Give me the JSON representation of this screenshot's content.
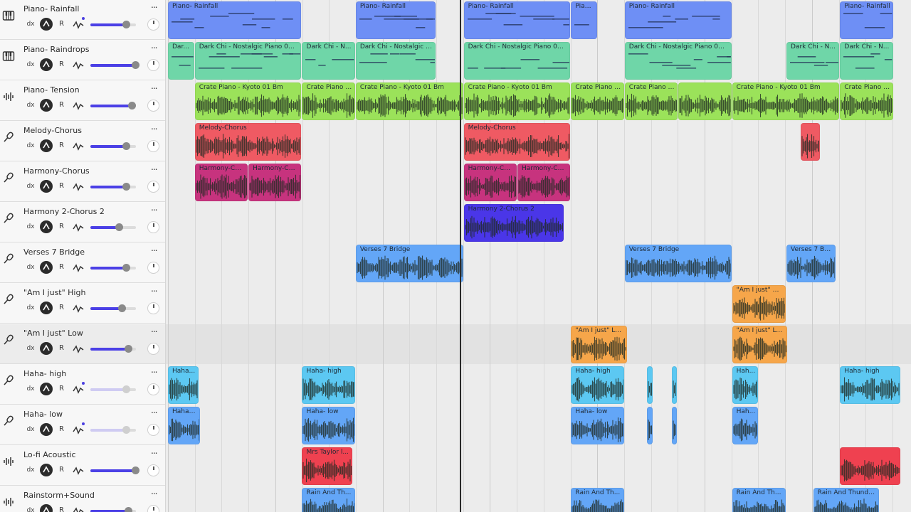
{
  "colors": {
    "accent": "#4b40e6",
    "blue": "#6e8ff5",
    "teal": "#6fd6a8",
    "green": "#9be25a",
    "red": "#ef5a63",
    "magenta": "#c7337e",
    "indigo": "#4a36e8",
    "skyblue": "#63a6f7",
    "orange": "#f6a64a",
    "cyan": "#5cc8f2",
    "rose": "#ef4150"
  },
  "icons": {
    "midi": "piano-keys-icon",
    "audio": "waveform-icon",
    "mic": "microphone-icon",
    "more": "ellipsis-icon",
    "mute": "mute-icon",
    "automation": "automation-icon",
    "pan": "pan-knob-icon"
  },
  "controls": {
    "fx": "dx",
    "record": "R",
    "more": "..."
  },
  "tracks": [
    {
      "name": "Piano- Rainfall",
      "kind": "midi",
      "volume": 0.78,
      "dim": false,
      "automation_dot": true
    },
    {
      "name": "Piano- Raindrops",
      "kind": "midi",
      "volume": 0.98,
      "dim": false,
      "automation_dot": false
    },
    {
      "name": "Piano- Tension",
      "kind": "audio",
      "volume": 0.9,
      "dim": false,
      "automation_dot": false
    },
    {
      "name": "Melody-Chorus",
      "kind": "mic",
      "volume": 0.78,
      "dim": false,
      "automation_dot": false
    },
    {
      "name": "Harmony-Chorus",
      "kind": "mic",
      "volume": 0.78,
      "dim": false,
      "automation_dot": false
    },
    {
      "name": "Harmony 2-Chorus 2",
      "kind": "mic",
      "volume": 0.63,
      "dim": false,
      "automation_dot": false
    },
    {
      "name": "Verses 7 Bridge",
      "kind": "mic",
      "volume": 0.78,
      "dim": false,
      "automation_dot": false
    },
    {
      "name": "\"Am I just\" High",
      "kind": "mic",
      "volume": 0.68,
      "dim": false,
      "automation_dot": false
    },
    {
      "name": "\"Am I just\" Low",
      "kind": "mic",
      "volume": 0.83,
      "dim": false,
      "automation_dot": false,
      "selected": true
    },
    {
      "name": "Haha- high",
      "kind": "mic",
      "volume": 0.78,
      "dim": true,
      "automation_dot": true
    },
    {
      "name": "Haha- low",
      "kind": "mic",
      "volume": 0.78,
      "dim": true,
      "automation_dot": true
    },
    {
      "name": "Lo-fi Acoustic",
      "kind": "audio",
      "volume": 0.98,
      "dim": false,
      "automation_dot": false
    },
    {
      "name": "Rainstorm+Sound",
      "kind": "audio",
      "volume": 0.83,
      "dim": false,
      "automation_dot": false
    }
  ],
  "regions": [
    {
      "track": 0,
      "name": "Piano- Rainfall",
      "start": 0.0,
      "end": 0.18,
      "color": "blue",
      "style": "midi"
    },
    {
      "track": 0,
      "name": "Piano- Rainfall",
      "start": 0.252,
      "end": 0.36,
      "color": "blue",
      "style": "midi"
    },
    {
      "track": 0,
      "name": "Piano- Rainfall",
      "start": 0.397,
      "end": 0.541,
      "color": "blue",
      "style": "midi"
    },
    {
      "track": 0,
      "name": "Pian...",
      "start": 0.541,
      "end": 0.577,
      "color": "blue",
      "style": "midi"
    },
    {
      "track": 0,
      "name": "Piano- Rainfall",
      "start": 0.613,
      "end": 0.757,
      "color": "blue",
      "style": "midi"
    },
    {
      "track": 0,
      "name": "Piano- Rainfall",
      "start": 0.902,
      "end": 0.974,
      "color": "blue",
      "style": "midi"
    },
    {
      "track": 1,
      "name": "Dar...",
      "start": 0.0,
      "end": 0.036,
      "color": "teal",
      "style": "midi"
    },
    {
      "track": 1,
      "name": "Dark Chi - Nostalgic Piano 07 D",
      "start": 0.036,
      "end": 0.18,
      "color": "teal",
      "style": "midi"
    },
    {
      "track": 1,
      "name": "Dark Chi - N...",
      "start": 0.18,
      "end": 0.252,
      "color": "teal",
      "style": "midi"
    },
    {
      "track": 1,
      "name": "Dark Chi - Nostalgic P...",
      "start": 0.252,
      "end": 0.36,
      "color": "teal",
      "style": "midi"
    },
    {
      "track": 1,
      "name": "Dark Chi - Nostalgic Piano 07 D",
      "start": 0.397,
      "end": 0.541,
      "color": "teal",
      "style": "midi"
    },
    {
      "track": 1,
      "name": "Dark Chi - Nostalgic Piano 07 D",
      "start": 0.613,
      "end": 0.757,
      "color": "teal",
      "style": "midi"
    },
    {
      "track": 1,
      "name": "Dark Chi - N...",
      "start": 0.83,
      "end": 0.902,
      "color": "teal",
      "style": "midi"
    },
    {
      "track": 1,
      "name": "Dark Chi - N...",
      "start": 0.902,
      "end": 0.974,
      "color": "teal",
      "style": "midi"
    },
    {
      "track": 2,
      "name": "Crate Piano - Kyoto 01 Bm",
      "start": 0.036,
      "end": 0.18,
      "color": "green",
      "style": "audio"
    },
    {
      "track": 2,
      "name": "Crate Piano - ...",
      "start": 0.18,
      "end": 0.252,
      "color": "green",
      "style": "audio"
    },
    {
      "track": 2,
      "name": "Crate Piano - Kyoto 01 Bm",
      "start": 0.252,
      "end": 0.397,
      "color": "green",
      "style": "audio"
    },
    {
      "track": 2,
      "name": "Crate Piano - Kyoto 01 Bm",
      "start": 0.397,
      "end": 0.541,
      "color": "green",
      "style": "audio"
    },
    {
      "track": 2,
      "name": "Crate Piano - ...",
      "start": 0.541,
      "end": 0.613,
      "color": "green",
      "style": "audio"
    },
    {
      "track": 2,
      "name": "Crate Piano - ...",
      "start": 0.613,
      "end": 0.685,
      "color": "green",
      "style": "audio"
    },
    {
      "track": 2,
      "name": "Crate Piano - Kyoto 01 Bm",
      "start": 0.757,
      "end": 0.902,
      "color": "green",
      "style": "audio"
    },
    {
      "track": 2,
      "name": "Crate Piano - ...",
      "start": 0.902,
      "end": 0.974,
      "color": "green",
      "style": "audio"
    },
    {
      "track": 2,
      "name": "",
      "start": 0.685,
      "end": 0.757,
      "color": "green",
      "style": "audio"
    },
    {
      "track": 3,
      "name": "Melody-Chorus",
      "start": 0.036,
      "end": 0.18,
      "color": "red",
      "style": "audio"
    },
    {
      "track": 3,
      "name": "Melody-Chorus",
      "start": 0.397,
      "end": 0.541,
      "color": "red",
      "style": "audio"
    },
    {
      "track": 3,
      "name": "",
      "start": 0.849,
      "end": 0.876,
      "color": "red",
      "style": "audio"
    },
    {
      "track": 4,
      "name": "Harmony-Ch...",
      "start": 0.036,
      "end": 0.108,
      "color": "magenta",
      "style": "audio"
    },
    {
      "track": 4,
      "name": "Harmony-Ch...",
      "start": 0.108,
      "end": 0.18,
      "color": "magenta",
      "style": "audio"
    },
    {
      "track": 4,
      "name": "Harmony-Ch...",
      "start": 0.397,
      "end": 0.469,
      "color": "magenta",
      "style": "audio"
    },
    {
      "track": 4,
      "name": "Harmony-Ch...",
      "start": 0.469,
      "end": 0.541,
      "color": "magenta",
      "style": "audio"
    },
    {
      "track": 5,
      "name": "Harmony 2-Chorus 2",
      "start": 0.397,
      "end": 0.532,
      "color": "indigo",
      "style": "audio"
    },
    {
      "track": 6,
      "name": "Verses 7 Bridge",
      "start": 0.252,
      "end": 0.397,
      "color": "skyblue",
      "style": "audio"
    },
    {
      "track": 6,
      "name": "Verses 7 Bridge",
      "start": 0.613,
      "end": 0.757,
      "color": "skyblue",
      "style": "audio"
    },
    {
      "track": 6,
      "name": "Verses 7 Bri...",
      "start": 0.83,
      "end": 0.897,
      "color": "skyblue",
      "style": "audio"
    },
    {
      "track": 7,
      "name": "\"Am I just\" High",
      "start": 0.757,
      "end": 0.83,
      "color": "orange",
      "style": "audio"
    },
    {
      "track": 8,
      "name": "\"Am I just\" Low",
      "start": 0.541,
      "end": 0.617,
      "color": "orange",
      "style": "audio"
    },
    {
      "track": 8,
      "name": "\"Am I just\" Low",
      "start": 0.757,
      "end": 0.832,
      "color": "orange",
      "style": "audio"
    },
    {
      "track": 9,
      "name": "Haha...",
      "start": 0.0,
      "end": 0.042,
      "color": "cyan",
      "style": "audio"
    },
    {
      "track": 9,
      "name": "Haha- high",
      "start": 0.18,
      "end": 0.252,
      "color": "cyan",
      "style": "audio"
    },
    {
      "track": 9,
      "name": "Haha- high",
      "start": 0.541,
      "end": 0.613,
      "color": "cyan",
      "style": "audio"
    },
    {
      "track": 9,
      "name": "",
      "start": 0.643,
      "end": 0.651,
      "color": "cyan",
      "style": "audio"
    },
    {
      "track": 9,
      "name": "",
      "start": 0.676,
      "end": 0.684,
      "color": "cyan",
      "style": "audio"
    },
    {
      "track": 9,
      "name": "Hah...",
      "start": 0.757,
      "end": 0.793,
      "color": "cyan",
      "style": "audio"
    },
    {
      "track": 9,
      "name": "Haha- high",
      "start": 0.902,
      "end": 0.984,
      "color": "cyan",
      "style": "audio"
    },
    {
      "track": 10,
      "name": "Haha-...",
      "start": 0.0,
      "end": 0.044,
      "color": "skyblue",
      "style": "audio"
    },
    {
      "track": 10,
      "name": "Haha- low",
      "start": 0.18,
      "end": 0.252,
      "color": "skyblue",
      "style": "audio"
    },
    {
      "track": 10,
      "name": "Haha- low",
      "start": 0.541,
      "end": 0.613,
      "color": "skyblue",
      "style": "audio"
    },
    {
      "track": 10,
      "name": "",
      "start": 0.643,
      "end": 0.651,
      "color": "skyblue",
      "style": "audio"
    },
    {
      "track": 10,
      "name": "",
      "start": 0.676,
      "end": 0.684,
      "color": "skyblue",
      "style": "audio"
    },
    {
      "track": 10,
      "name": "Hah...",
      "start": 0.757,
      "end": 0.793,
      "color": "skyblue",
      "style": "audio"
    },
    {
      "track": 11,
      "name": "Mrs Taylor l...",
      "start": 0.18,
      "end": 0.248,
      "color": "rose",
      "style": "audio"
    },
    {
      "track": 11,
      "name": "",
      "start": 0.902,
      "end": 0.984,
      "color": "rose",
      "style": "audio"
    },
    {
      "track": 12,
      "name": "Rain And Th...",
      "start": 0.18,
      "end": 0.252,
      "color": "skyblue",
      "style": "audio"
    },
    {
      "track": 12,
      "name": "Rain And Th...",
      "start": 0.541,
      "end": 0.613,
      "color": "skyblue",
      "style": "audio"
    },
    {
      "track": 12,
      "name": "Rain And Th...",
      "start": 0.757,
      "end": 0.83,
      "color": "skyblue",
      "style": "audio"
    },
    {
      "track": 12,
      "name": "Rain And Thunde...",
      "start": 0.866,
      "end": 0.955,
      "color": "skyblue",
      "style": "audio"
    }
  ],
  "playhead_position": 0.392
}
